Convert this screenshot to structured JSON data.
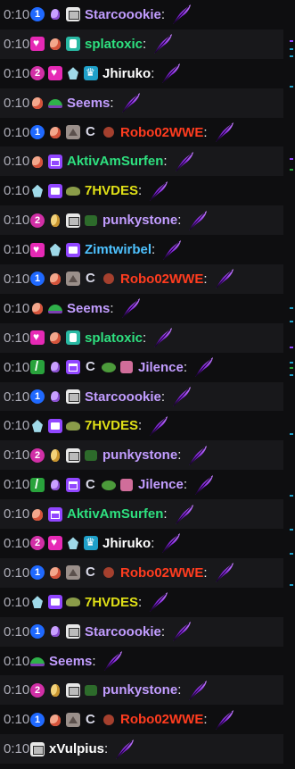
{
  "colors": {
    "Starcoookie": "#c29dff",
    "splatoxic": "#2ee07f",
    "Jhiruko": "#ffffff",
    "Seems": "#c29dff",
    "Robo02WWE": "#ff3c1f",
    "AktivAmSurfen": "#2ee07f",
    "7HVDES": "#e0e017",
    "punkystone": "#c29dff",
    "Zimtwirbel": "#4ec2ff",
    "Jilence": "#c29dff",
    "xVulpius": "#ffffff"
  },
  "messages": [
    {
      "time": "0:10",
      "badges": [
        "b-sub1",
        "b-gem",
        "b-chip"
      ],
      "user": "Starcoookie"
    },
    {
      "time": "0:10",
      "badges": [
        "b-heart",
        "b-flame",
        "b-teal"
      ],
      "user": "splatoxic"
    },
    {
      "time": "0:10",
      "badges": [
        "b-sub2",
        "b-heart",
        "b-crystal",
        "b-crown"
      ],
      "user": "Jhiruko"
    },
    {
      "time": "0:10",
      "badges": [
        "b-flame",
        "b-hat"
      ],
      "user": "Seems"
    },
    {
      "time": "0:10",
      "badges": [
        "b-sub1",
        "b-flame",
        "b-grey",
        "b-c",
        "b-robot"
      ],
      "user": "Robo02WWE"
    },
    {
      "time": "0:10",
      "badges": [
        "b-flame",
        "b-gift"
      ],
      "user": "AktivAmSurfen"
    },
    {
      "time": "0:10",
      "badges": [
        "b-crystal",
        "b-prime",
        "b-turtle"
      ],
      "user": "7HVDES"
    },
    {
      "time": "0:10",
      "badges": [
        "b-sub2",
        "b-egg",
        "b-chip",
        "b-bear"
      ],
      "user": "punkystone"
    },
    {
      "time": "0:10",
      "badges": [
        "b-heart",
        "b-crystal",
        "b-prime"
      ],
      "user": "Zimtwirbel"
    },
    {
      "time": "0:10",
      "badges": [
        "b-sub1",
        "b-flame",
        "b-grey",
        "b-c",
        "b-robot"
      ],
      "user": "Robo02WWE"
    },
    {
      "time": "0:10",
      "badges": [
        "b-flame",
        "b-hat"
      ],
      "user": "Seems"
    },
    {
      "time": "0:10",
      "badges": [
        "b-heart",
        "b-flame",
        "b-teal"
      ],
      "user": "splatoxic"
    },
    {
      "time": "0:10",
      "badges": [
        "b-sword",
        "b-gem",
        "b-gift",
        "b-c",
        "b-pepe",
        "b-monkey"
      ],
      "user": "Jilence"
    },
    {
      "time": "0:10",
      "badges": [
        "b-sub1",
        "b-gem",
        "b-chip"
      ],
      "user": "Starcoookie"
    },
    {
      "time": "0:10",
      "badges": [
        "b-crystal",
        "b-prime",
        "b-turtle"
      ],
      "user": "7HVDES"
    },
    {
      "time": "0:10",
      "badges": [
        "b-sub2",
        "b-egg",
        "b-chip",
        "b-bear"
      ],
      "user": "punkystone"
    },
    {
      "time": "0:10",
      "badges": [
        "b-sword",
        "b-gem",
        "b-gift",
        "b-c",
        "b-pepe",
        "b-monkey"
      ],
      "user": "Jilence"
    },
    {
      "time": "0:10",
      "badges": [
        "b-flame",
        "b-gift"
      ],
      "user": "AktivAmSurfen"
    },
    {
      "time": "0:10",
      "badges": [
        "b-sub2",
        "b-heart",
        "b-crystal",
        "b-crown"
      ],
      "user": "Jhiruko"
    },
    {
      "time": "0:10",
      "badges": [
        "b-sub1",
        "b-flame",
        "b-grey",
        "b-c",
        "b-robot"
      ],
      "user": "Robo02WWE"
    },
    {
      "time": "0:10",
      "badges": [
        "b-crystal",
        "b-prime",
        "b-turtle"
      ],
      "user": "7HVDES"
    },
    {
      "time": "0:10",
      "badges": [
        "b-sub1",
        "b-gem",
        "b-chip"
      ],
      "user": "Starcoookie"
    },
    {
      "time": "0:10",
      "badges": [
        "b-hat"
      ],
      "user": "Seems"
    },
    {
      "time": "0:10",
      "badges": [
        "b-sub2",
        "b-egg",
        "b-chip",
        "b-bear"
      ],
      "user": "punkystone"
    },
    {
      "time": "0:10",
      "badges": [
        "b-sub1",
        "b-flame",
        "b-grey",
        "b-c",
        "b-robot"
      ],
      "user": "Robo02WWE"
    },
    {
      "time": "0:10",
      "badges": [
        "b-chip"
      ],
      "user": "xVulpius"
    }
  ],
  "badge_numbers": {
    "b-sub1": "1",
    "b-sub2": "2"
  },
  "colon": ":",
  "emote_icon": "purple-feather-emote-icon",
  "scroll_markers": [
    {
      "color": "#9146ff"
    },
    {
      "color": "#1fa0c9"
    },
    {
      "color": "#1fa0c9"
    },
    {
      "color": "#1fa0c9"
    },
    {
      "color": "#9146ff"
    },
    {
      "color": "#29a33c"
    },
    {
      "color": "#1fa0c9"
    },
    {
      "color": "#1fa0c9"
    },
    {
      "color": "#9146ff"
    },
    {
      "color": "#1fa0c9"
    },
    {
      "color": "#29a33c"
    },
    {
      "color": "#1fa0c9"
    },
    {
      "color": "#1fa0c9"
    },
    {
      "color": "#1fa0c9"
    },
    {
      "color": "#1fa0c9"
    },
    {
      "color": "#1fa0c9"
    },
    {
      "color": "#1fa0c9"
    }
  ]
}
